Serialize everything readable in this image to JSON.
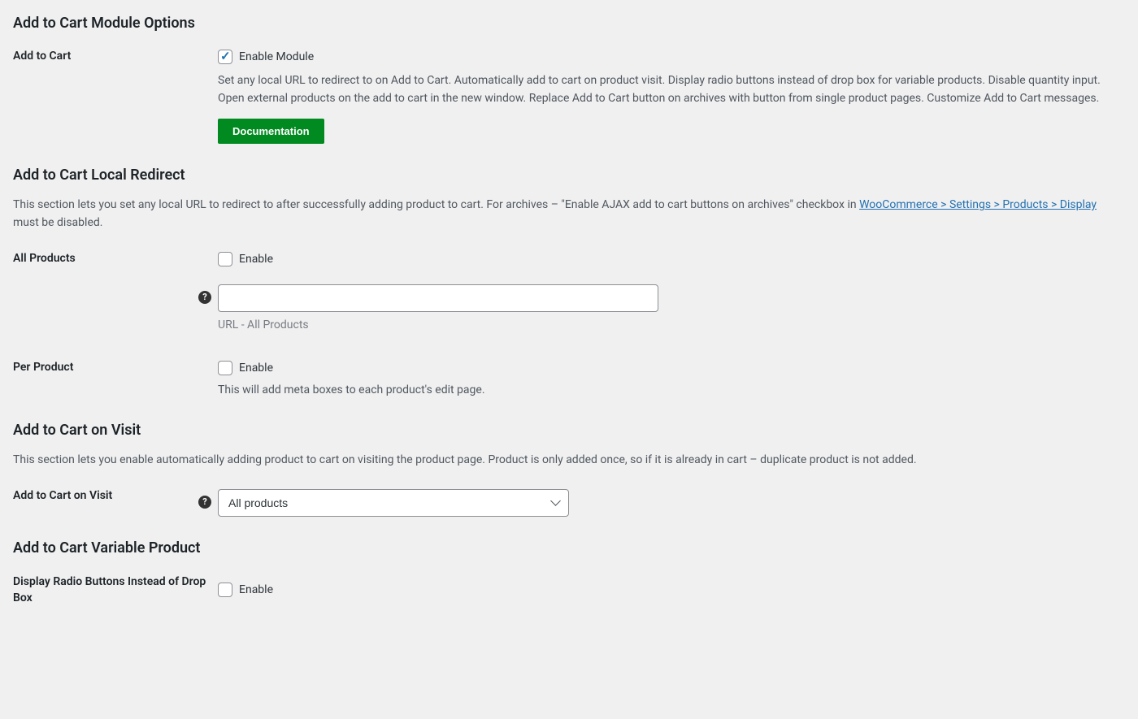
{
  "module": {
    "title": "Add to Cart Module Options",
    "label": "Add to Cart",
    "enable_label": "Enable Module",
    "description": "Set any local URL to redirect to on Add to Cart. Automatically add to cart on product visit. Display radio buttons instead of drop box for variable products. Disable quantity input. Open external products on the add to cart in the new window. Replace Add to Cart button on archives with button from single product pages. Customize Add to Cart messages.",
    "doc_button": "Documentation"
  },
  "redirect": {
    "title": "Add to Cart Local Redirect",
    "desc_before_link": "This section lets you set any local URL to redirect to after successfully adding product to cart. For archives – \"Enable AJAX add to cart buttons on archives\" checkbox in ",
    "link_text": "WooCommerce > Settings > Products > Display",
    "desc_after_link": " must be disabled.",
    "all_products_label": "All Products",
    "enable_label": "Enable",
    "url_sub": "URL - All Products",
    "url_value": "",
    "per_product_label": "Per Product",
    "per_product_desc": "This will add meta boxes to each product's edit page."
  },
  "visit": {
    "title": "Add to Cart on Visit",
    "desc": "This section lets you enable automatically adding product to cart on visiting the product page. Product is only added once, so if it is already in cart – duplicate product is not added.",
    "label": "Add to Cart on Visit",
    "select_value": "All products"
  },
  "variable": {
    "title": "Add to Cart Variable Product",
    "label": "Display Radio Buttons Instead of Drop Box",
    "enable_label": "Enable"
  }
}
